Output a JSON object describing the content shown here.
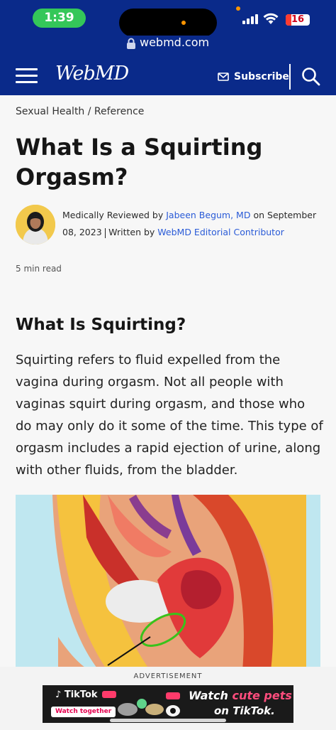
{
  "status_bar": {
    "time": "1:39",
    "battery": "16",
    "url": "webmd.com"
  },
  "header": {
    "logo": "WebMD",
    "subscribe_label": "Subscribe",
    "icons": [
      "menu-icon",
      "mail-icon",
      "search-icon"
    ]
  },
  "article": {
    "breadcrumb": "Sexual Health / Reference",
    "title": "What Is a Squirting Orgasm?",
    "byline": {
      "reviewed_prefix": "Medically Reviewed by",
      "reviewer": "Jabeen Begum, MD",
      "date_prefix": "on",
      "date": "September 08, 2023",
      "written_prefix": "Written by",
      "author": "WebMD Editorial Contributor"
    },
    "read_time": "5 min read",
    "section_heading": "What Is Squirting?",
    "paragraph": "Squirting refers to fluid expelled from the vagina during orgasm. Not all people with vaginas squirt during orgasm, and those who do may only do it some of the time. This type of orgasm includes a rapid ejection of urine, along with other fluids, from the bladder."
  },
  "ad": {
    "label": "ADVERTISEMENT",
    "brand": "TikTok",
    "tagline_pill": "Watch together",
    "headline_prefix": "Watch",
    "headline_accent": "cute pets",
    "subline": "on TikTok."
  },
  "colors": {
    "nav_bg": "#0a2a8a",
    "link": "#2a5bd7",
    "time_pill": "#34c759"
  }
}
